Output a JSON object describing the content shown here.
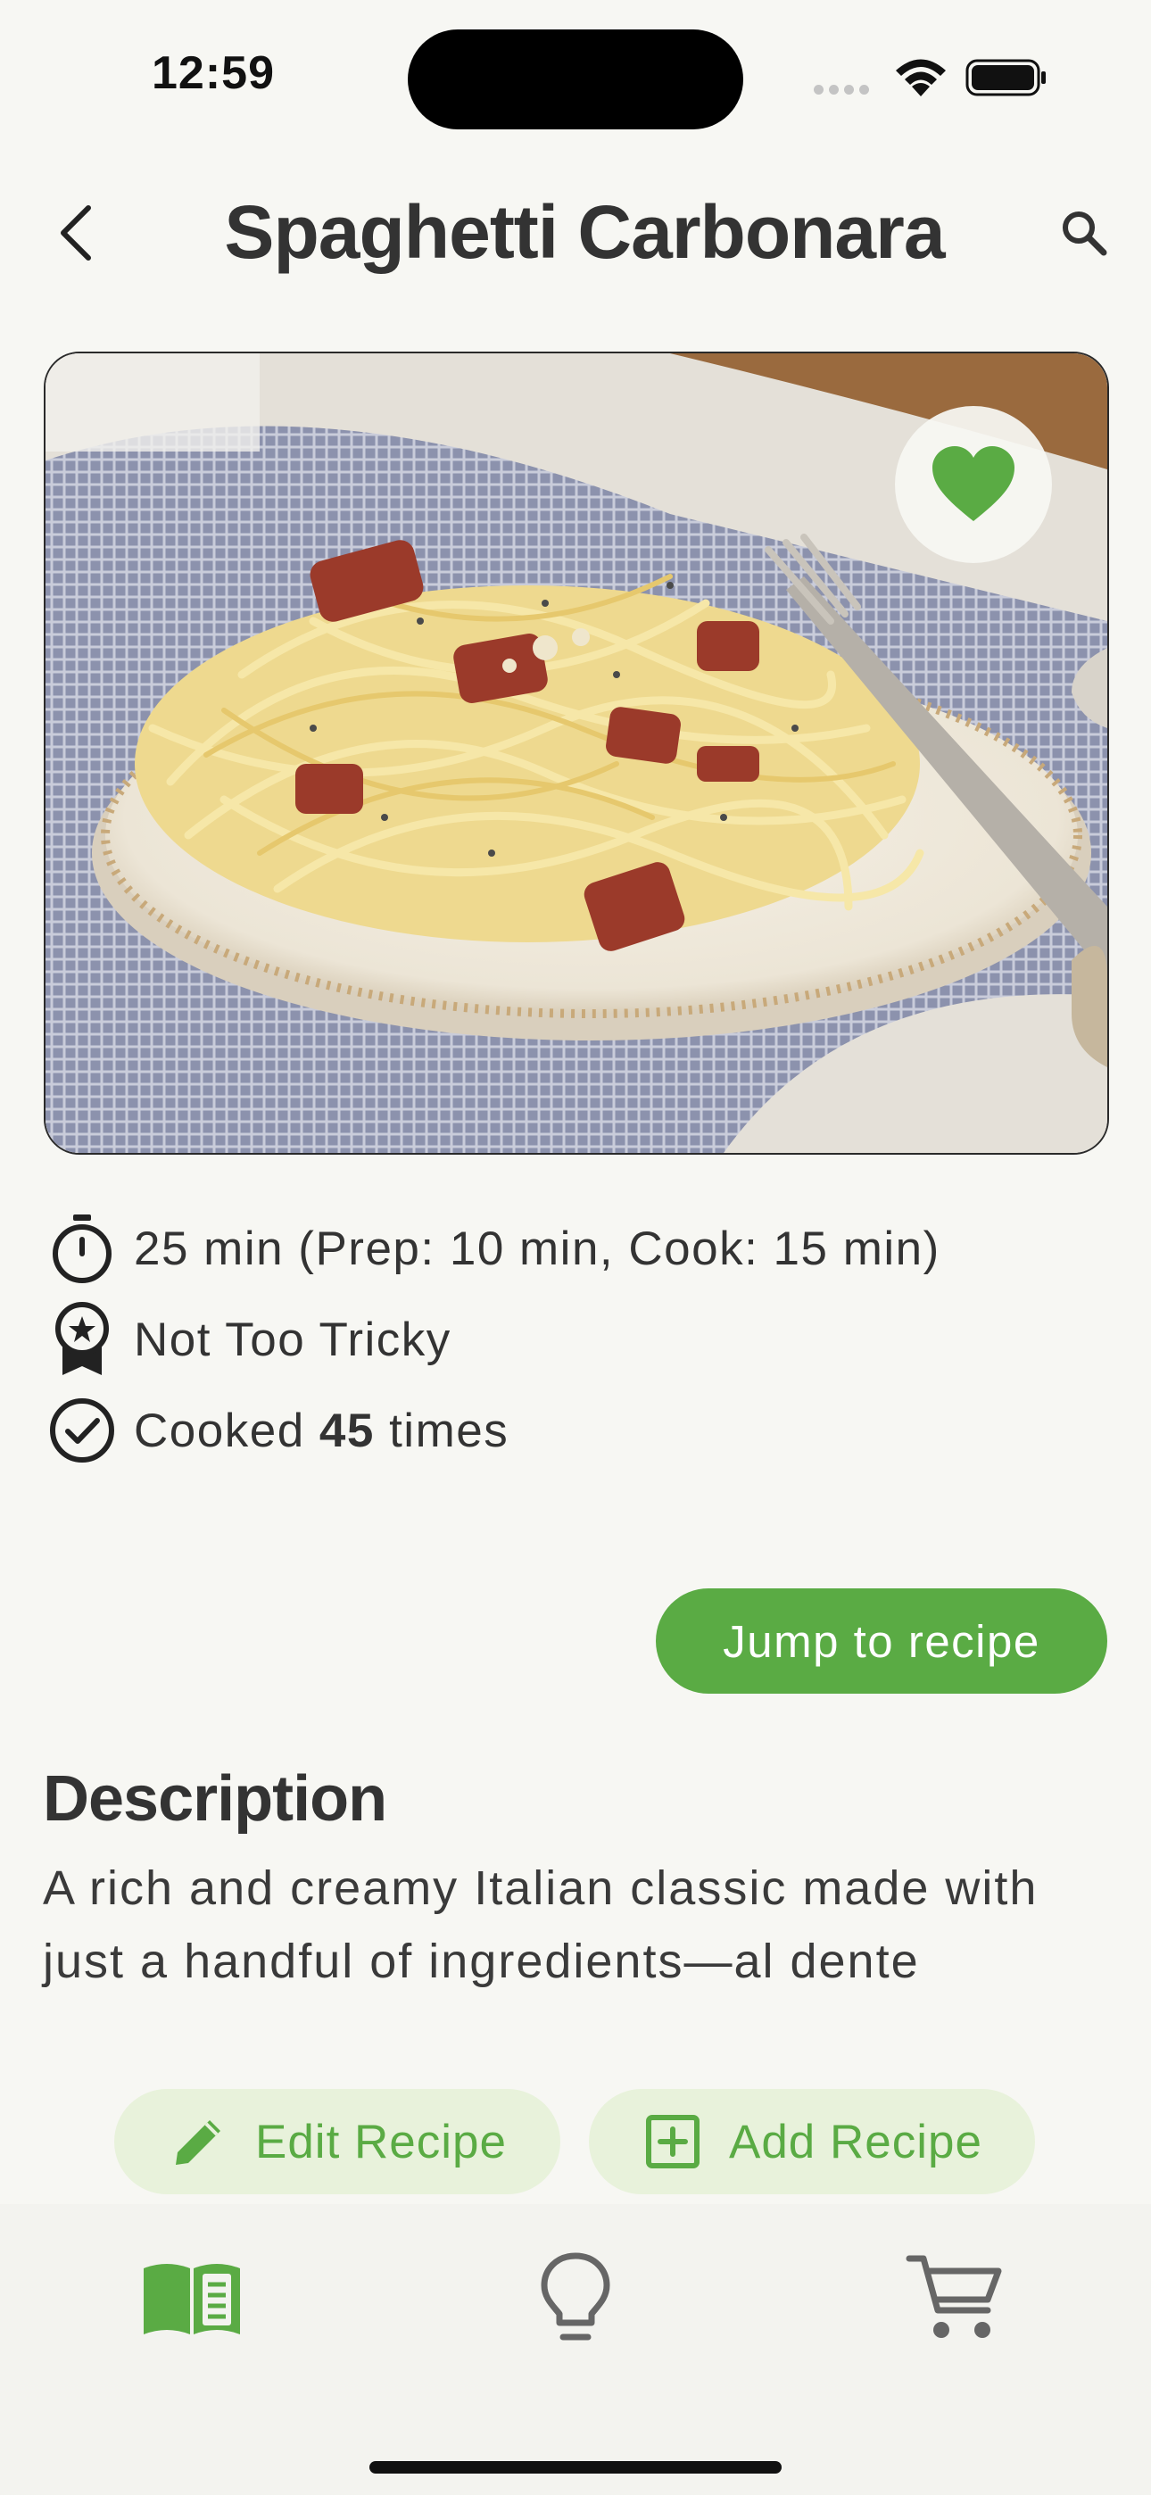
{
  "status_bar": {
    "time": "12:59"
  },
  "header": {
    "title": "Spaghetti Carbonara"
  },
  "recipe": {
    "is_favorite": true,
    "time_text": "25 min (Prep: 10 min, Cook: 15 min)",
    "difficulty": "Not Too Tricky",
    "cooked_prefix": "Cooked ",
    "cooked_count": "45",
    "cooked_suffix": " times"
  },
  "actions": {
    "jump_label": "Jump to recipe"
  },
  "description": {
    "heading": "Description",
    "text": "A rich and creamy Italian classic made with just a handful of ingredients—al dente"
  },
  "buttons": {
    "edit_label": "Edit Recipe",
    "add_label": "Add Recipe"
  },
  "tabs": [
    {
      "icon": "book-icon",
      "active": true
    },
    {
      "icon": "lightbulb-icon",
      "active": false
    },
    {
      "icon": "cart-icon",
      "active": false
    }
  ],
  "colors": {
    "accent": "#5aab44",
    "pill_bg": "#e8f2db",
    "background": "#f7f7f3",
    "text": "#333333"
  }
}
